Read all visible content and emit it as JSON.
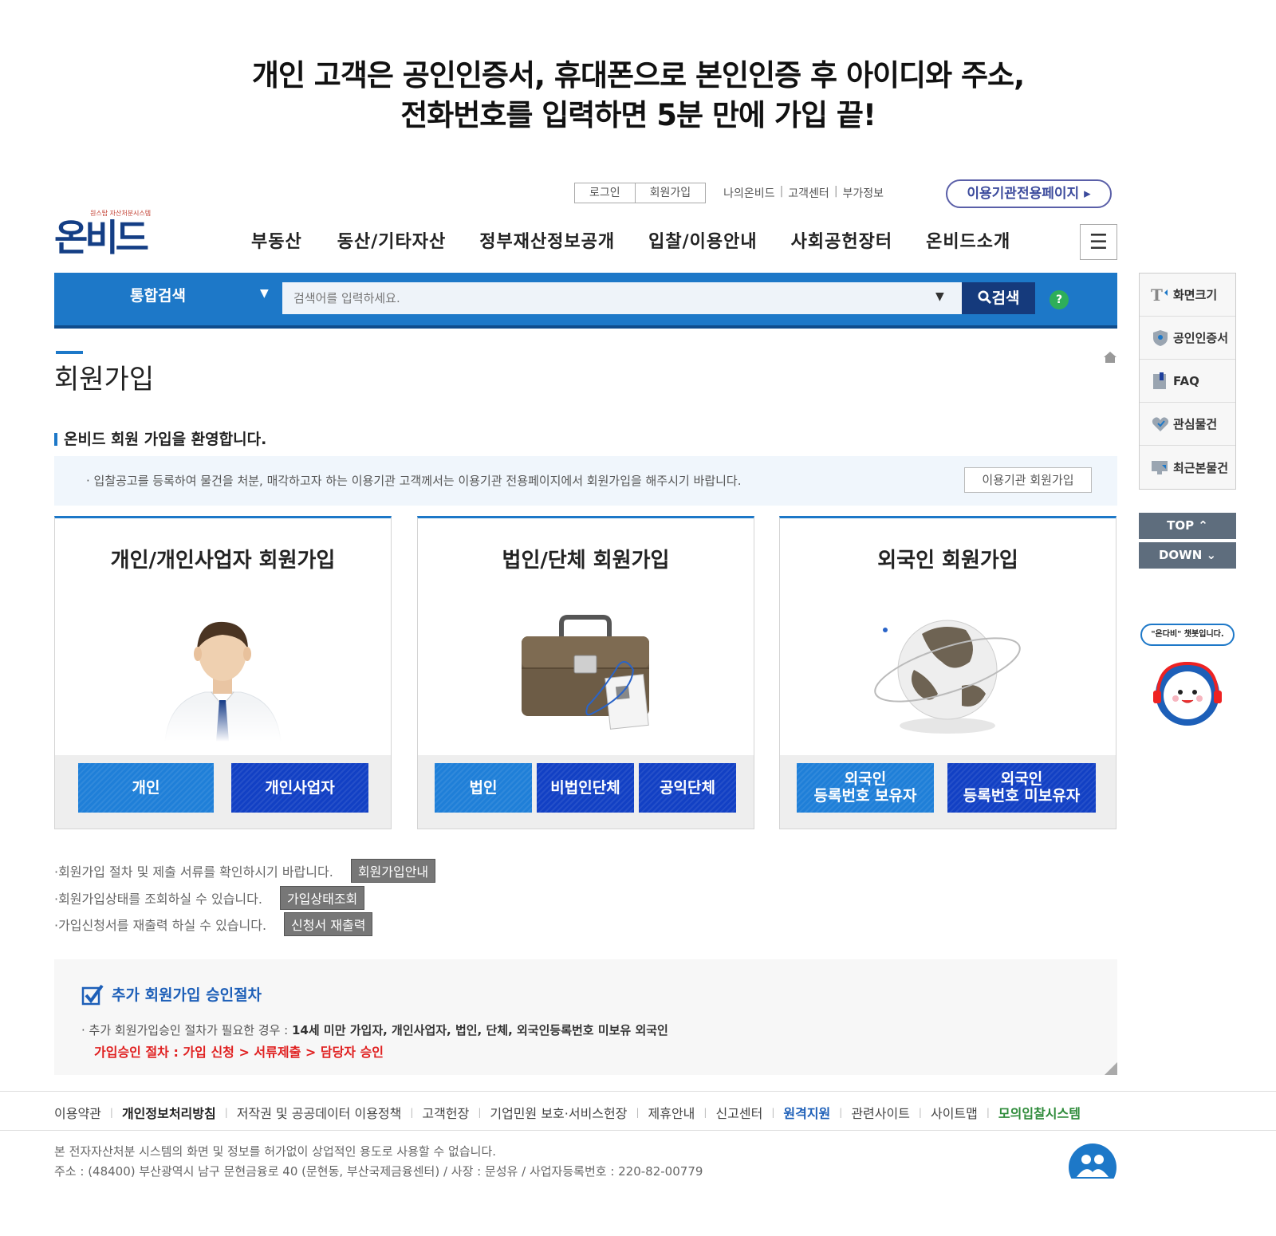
{
  "headline": {
    "line1": "개인 고객은 공인인증서, 휴대폰으로 본인인증 후 아이디와 주소,",
    "line2": "전화번호를 입력하면 5분 만에 가입 끝!"
  },
  "util": {
    "login": "로그인",
    "join": "회원가입",
    "links": [
      "나의온비드",
      "고객센터",
      "부가정보"
    ],
    "org_page": "이용기관전용페이지 ▸"
  },
  "logo": {
    "text": "온비드",
    "sub": "원스탑 자산처분시스템"
  },
  "gnb": [
    "부동산",
    "동산/기타자산",
    "정부재산정보공개",
    "입찰/이용안내",
    "사회공헌장터",
    "온비드소개"
  ],
  "search": {
    "category": "통합검색",
    "placeholder": "검색어를 입력하세요.",
    "button": "검색",
    "help": "?"
  },
  "page": {
    "title": "회원가입",
    "welcome": "온비드 회원 가입을 환영합니다.",
    "notice": "· 입찰공고를 등록하여 물건을 처분, 매각하고자 하는 이용기관 고객께서는 이용기관 전용페이지에서 회원가입을 해주시기 바랍니다.",
    "notice_button": "이용기관 회원가입"
  },
  "cards": [
    {
      "title": "개인/개인사업자 회원가입",
      "buttons": [
        "개인",
        "개인사업자"
      ]
    },
    {
      "title": "법인/단체 회원가입",
      "buttons": [
        "법인",
        "비법인단체",
        "공익단체"
      ]
    },
    {
      "title": "외국인 회원가입",
      "buttons": [
        "외국인\n등록번호 보유자",
        "외국인\n등록번호 미보유자"
      ]
    }
  ],
  "info": [
    {
      "text": "·회원가입 절차 및 제출 서류를 확인하시기 바랍니다.",
      "button": "회원가입안내"
    },
    {
      "text": "·회원가입상태를 조회하실 수 있습니다.",
      "button": "가입상태조회"
    },
    {
      "text": "·가입신청서를 재출력 하실 수 있습니다.",
      "button": "신청서 재출력"
    }
  ],
  "additional": {
    "title": "추가 회원가입 승인절차",
    "desc_prefix": "· 추가 회원가입승인 절차가 필요한 경우 : ",
    "desc_bold": "14세 미만 가입자, 개인사업자, 법인, 단체, 외국인등록번호 미보유 외국인",
    "steps": "가입승인 절차 : 가입 신청 > 서류제출 > 담당자 승인"
  },
  "footer": {
    "links": [
      "이용약관",
      "개인정보처리방침",
      "저작권 및 공공데이터 이용정책",
      "고객헌장",
      "기업민원 보호·서비스헌장",
      "제휴안내",
      "신고센터",
      "원격지원",
      "관련사이트",
      "사이트맵",
      "모의입찰시스템"
    ],
    "copy1": "본 전자자산처분 시스템의 화면 및 정보를 허가없이 상업적인 용도로 사용할 수 없습니다.",
    "copy2": "주소 : (48400) 부산광역시 남구 문현금융로 40 (문현동, 부산국제금융센터) / 사장 : 문성유 / 사업자등록번호 : 220-82-00779"
  },
  "quick": {
    "items": [
      "화면크기",
      "공인인증서",
      "FAQ",
      "관심물건",
      "최근본물건"
    ],
    "top": "TOP ⌃",
    "down": "DOWN ⌄",
    "chatbot": "\"온다비\" 챗봇입니다."
  },
  "colors": {
    "primary": "#1d78c8",
    "navy": "#153a7c",
    "dark_button": "#1240c4",
    "light_button": "#1f7fd8",
    "red": "#e02020"
  }
}
